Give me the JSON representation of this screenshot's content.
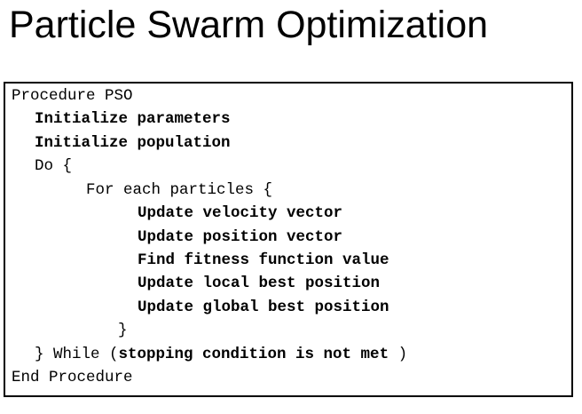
{
  "title": "Particle Swarm Optimization",
  "code": {
    "procedure_header": "Procedure PSO",
    "init_parameters": "Initialize parameters",
    "init_population": "Initialize population",
    "do_open": "Do {",
    "for_each": "For each particles {",
    "update_velocity": "Update velocity vector",
    "update_position": "Update position vector",
    "find_fitness": "Find fitness function value",
    "update_local": "Update local best position",
    "update_global": "Update global best position",
    "for_close": "}",
    "while_prefix": "} While (",
    "while_condition": "stopping condition is not met",
    "while_suffix": " )",
    "end_procedure": "End Procedure"
  }
}
